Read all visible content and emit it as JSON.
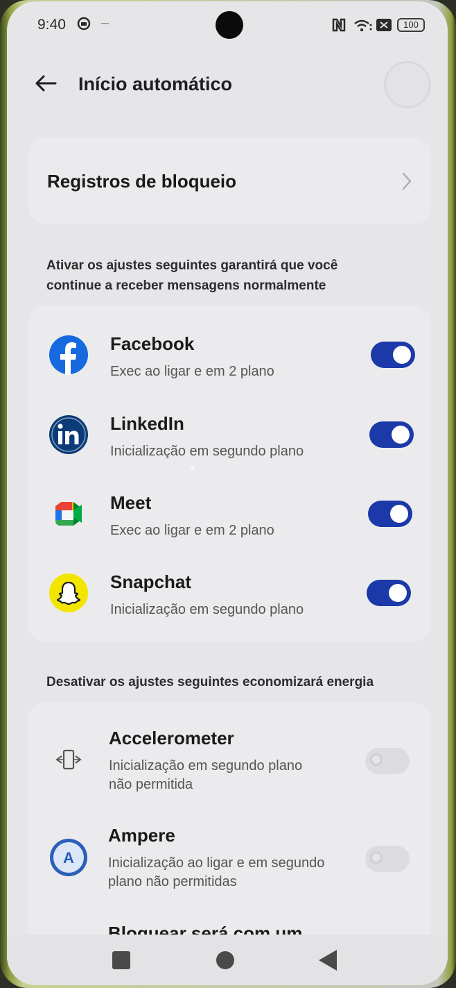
{
  "status_bar": {
    "time": "9:40",
    "dash": "–",
    "battery": "100"
  },
  "header": {
    "title": "Início automático"
  },
  "block_log": {
    "label": "Registros de bloqueio"
  },
  "enable_section": {
    "caption": "Ativar os ajustes seguintes garantirá que você continue a receber mensagens normalmente",
    "apps": [
      {
        "name": "Facebook",
        "subtitle": "Exec ao ligar e em 2 plano",
        "icon": "facebook-icon",
        "enabled": true
      },
      {
        "name": "LinkedIn",
        "subtitle": "Inicialização em segundo plano",
        "icon": "linkedin-icon",
        "enabled": true
      },
      {
        "name": "Meet",
        "subtitle": "Exec ao ligar e em 2 plano",
        "icon": "meet-icon",
        "enabled": true
      },
      {
        "name": "Snapchat",
        "subtitle": "Inicialização em segundo plano",
        "icon": "snapchat-icon",
        "enabled": true
      }
    ]
  },
  "disable_section": {
    "caption": "Desativar os ajustes seguintes economizará energia",
    "apps": [
      {
        "name": "Accelerometer",
        "subtitle_line1": "Inicialização em segundo plano",
        "subtitle_line2": "não permitida",
        "icon": "accelerometer-icon",
        "enabled": false
      },
      {
        "name": "Ampere",
        "subtitle_line1": "Inicialização ao ligar e em segundo",
        "subtitle_line2": "plano não permitidas",
        "icon": "ampere-icon",
        "enabled": false
      }
    ],
    "partial_next_item": "Bloquear será com um"
  },
  "colors": {
    "toggle_on": "#1b39a8",
    "facebook": "#1769e0",
    "linkedin": "#0b3b78",
    "snapchat": "#f2e600",
    "ampere": "#2b5fb8"
  }
}
